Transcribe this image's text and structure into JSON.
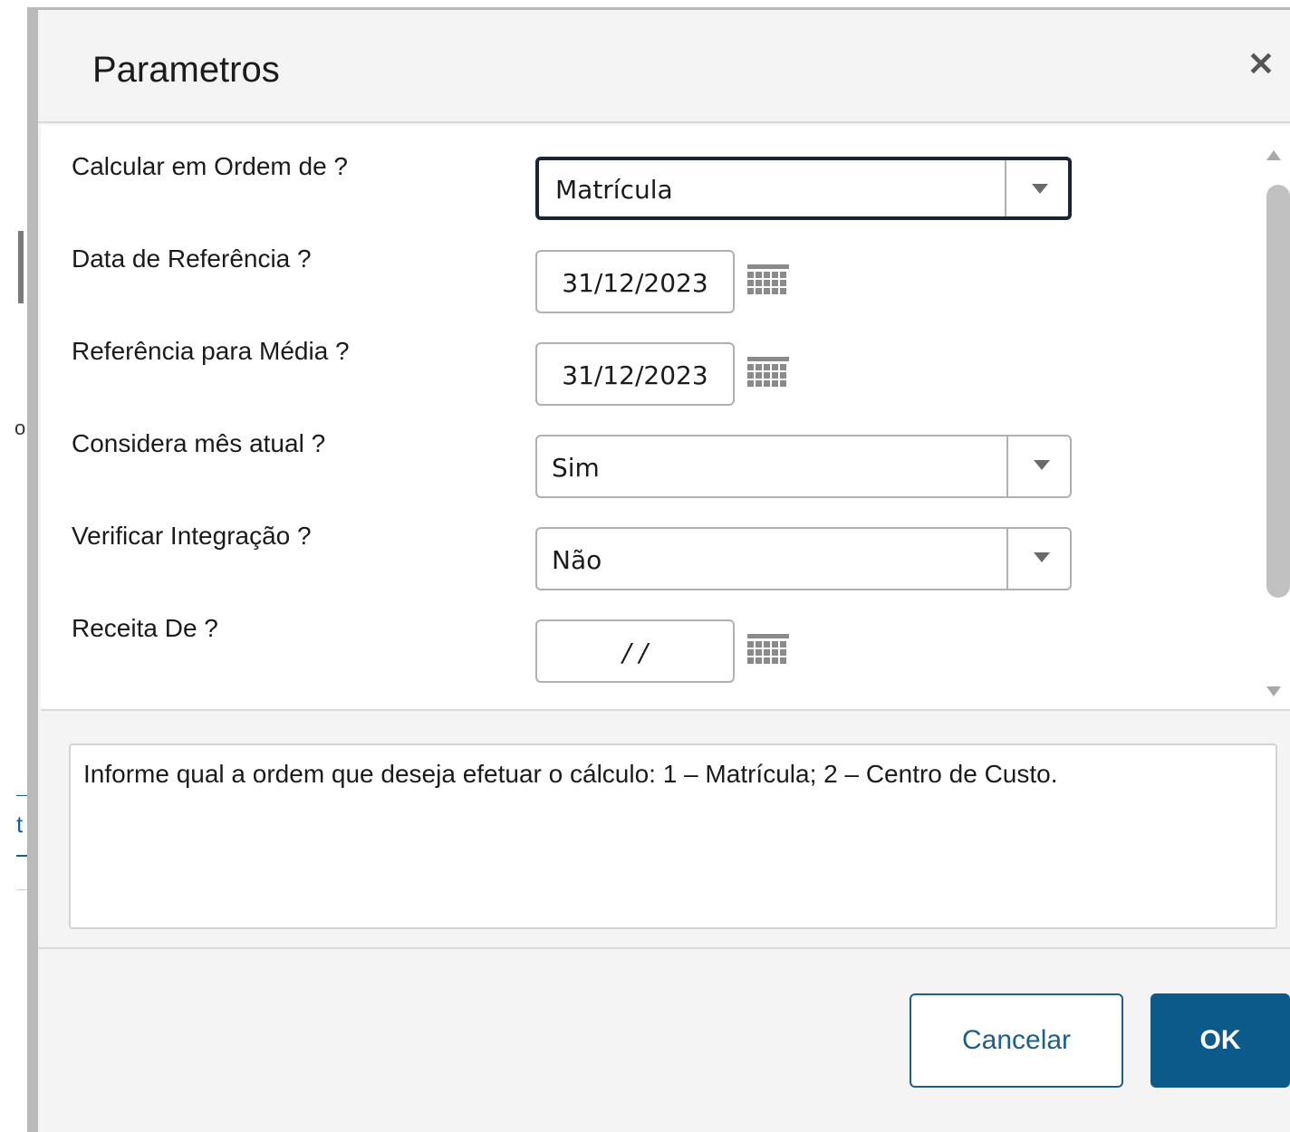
{
  "dialog": {
    "title": "Parametros",
    "close_icon": "close-icon"
  },
  "background": {
    "fragment_1": "o",
    "fragment_2": "t"
  },
  "fields": [
    {
      "label": "Calcular em Ordem de ?",
      "type": "select",
      "value": "Matrícula",
      "focused": true
    },
    {
      "label": "Data de Referência ?",
      "type": "date",
      "value": "31/12/2023"
    },
    {
      "label": "Referência para Média ?",
      "type": "date",
      "value": "31/12/2023"
    },
    {
      "label": "Considera mês atual ?",
      "type": "select",
      "value": "Sim"
    },
    {
      "label": "Verificar Integração ?",
      "type": "select",
      "value": "Não"
    },
    {
      "label": "Receita De ?",
      "type": "date",
      "value": " / /"
    }
  ],
  "help": {
    "text": "Informe qual a ordem que deseja efetuar o cálculo: 1 – Matrícula; 2 – Centro de Custo."
  },
  "footer": {
    "cancel_label": "Cancelar",
    "ok_label": "OK"
  },
  "colors": {
    "primary": "#0b5a8a",
    "focus_border": "#1c2430"
  }
}
